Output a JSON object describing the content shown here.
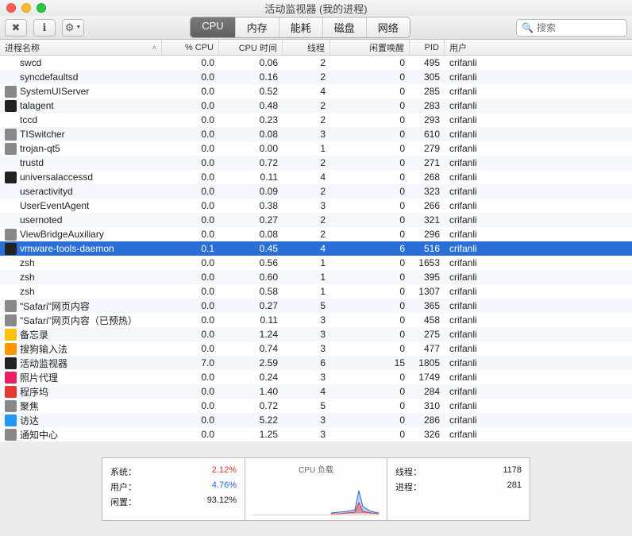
{
  "window": {
    "title": "活动监视器 (我的进程)"
  },
  "toolbar": {
    "stop_icon": "✖",
    "info_icon": "ℹ",
    "gear_icon": "⚙",
    "tabs": [
      "CPU",
      "内存",
      "能耗",
      "磁盘",
      "网络"
    ],
    "search_placeholder": "搜索",
    "search_icon": "🔍"
  },
  "columns": {
    "name": "进程名称",
    "cpu": "% CPU",
    "time": "CPU 时间",
    "thread": "线程",
    "wake": "闲置唤醒",
    "pid": "PID",
    "user": "用户"
  },
  "rows": [
    {
      "icon": "blank",
      "name": "swcd",
      "cpu": "0.0",
      "time": "0.06",
      "thread": "2",
      "wake": "0",
      "pid": "495",
      "user": "crifanli"
    },
    {
      "icon": "blank",
      "name": "syncdefaultsd",
      "cpu": "0.0",
      "time": "0.16",
      "thread": "2",
      "wake": "0",
      "pid": "305",
      "user": "crifanli"
    },
    {
      "icon": "gray",
      "name": "SystemUIServer",
      "cpu": "0.0",
      "time": "0.52",
      "thread": "4",
      "wake": "0",
      "pid": "285",
      "user": "crifanli"
    },
    {
      "icon": "black",
      "name": "talagent",
      "cpu": "0.0",
      "time": "0.48",
      "thread": "2",
      "wake": "0",
      "pid": "283",
      "user": "crifanli"
    },
    {
      "icon": "blank",
      "name": "tccd",
      "cpu": "0.0",
      "time": "0.23",
      "thread": "2",
      "wake": "0",
      "pid": "293",
      "user": "crifanli"
    },
    {
      "icon": "gray",
      "name": "TISwitcher",
      "cpu": "0.0",
      "time": "0.08",
      "thread": "3",
      "wake": "0",
      "pid": "610",
      "user": "crifanli"
    },
    {
      "icon": "gray",
      "name": "trojan-qt5",
      "cpu": "0.0",
      "time": "0.00",
      "thread": "1",
      "wake": "0",
      "pid": "279",
      "user": "crifanli"
    },
    {
      "icon": "blank",
      "name": "trustd",
      "cpu": "0.0",
      "time": "0.72",
      "thread": "2",
      "wake": "0",
      "pid": "271",
      "user": "crifanli"
    },
    {
      "icon": "black",
      "name": "universalaccessd",
      "cpu": "0.0",
      "time": "0.11",
      "thread": "4",
      "wake": "0",
      "pid": "268",
      "user": "crifanli"
    },
    {
      "icon": "blank",
      "name": "useractivityd",
      "cpu": "0.0",
      "time": "0.09",
      "thread": "2",
      "wake": "0",
      "pid": "323",
      "user": "crifanli"
    },
    {
      "icon": "blank",
      "name": "UserEventAgent",
      "cpu": "0.0",
      "time": "0.38",
      "thread": "3",
      "wake": "0",
      "pid": "266",
      "user": "crifanli"
    },
    {
      "icon": "blank",
      "name": "usernoted",
      "cpu": "0.0",
      "time": "0.27",
      "thread": "2",
      "wake": "0",
      "pid": "321",
      "user": "crifanli"
    },
    {
      "icon": "gray",
      "name": "ViewBridgeAuxiliary",
      "cpu": "0.0",
      "time": "0.08",
      "thread": "2",
      "wake": "0",
      "pid": "296",
      "user": "crifanli"
    },
    {
      "icon": "black",
      "name": "vmware-tools-daemon",
      "cpu": "0.1",
      "time": "0.45",
      "thread": "4",
      "wake": "6",
      "pid": "516",
      "user": "crifanli",
      "selected": true
    },
    {
      "icon": "blank",
      "name": "zsh",
      "cpu": "0.0",
      "time": "0.56",
      "thread": "1",
      "wake": "0",
      "pid": "1653",
      "user": "crifanli"
    },
    {
      "icon": "blank",
      "name": "zsh",
      "cpu": "0.0",
      "time": "0.60",
      "thread": "1",
      "wake": "0",
      "pid": "395",
      "user": "crifanli"
    },
    {
      "icon": "blank",
      "name": "zsh",
      "cpu": "0.0",
      "time": "0.58",
      "thread": "1",
      "wake": "0",
      "pid": "1307",
      "user": "crifanli"
    },
    {
      "icon": "gray",
      "name": "\"Safari\"网页内容",
      "cpu": "0.0",
      "time": "0.27",
      "thread": "5",
      "wake": "0",
      "pid": "365",
      "user": "crifanli"
    },
    {
      "icon": "gray",
      "name": "\"Safari\"网页内容（已预热）",
      "cpu": "0.0",
      "time": "0.11",
      "thread": "3",
      "wake": "0",
      "pid": "458",
      "user": "crifanli"
    },
    {
      "icon": "yellow",
      "name": "备忘录",
      "cpu": "0.0",
      "time": "1.24",
      "thread": "3",
      "wake": "0",
      "pid": "275",
      "user": "crifanli"
    },
    {
      "icon": "orange",
      "name": "搜狗输入法",
      "cpu": "0.0",
      "time": "0.74",
      "thread": "3",
      "wake": "0",
      "pid": "477",
      "user": "crifanli"
    },
    {
      "icon": "black",
      "name": "活动监视器",
      "cpu": "7.0",
      "time": "2.59",
      "thread": "6",
      "wake": "15",
      "pid": "1805",
      "user": "crifanli"
    },
    {
      "icon": "pink",
      "name": "照片代理",
      "cpu": "0.0",
      "time": "0.24",
      "thread": "3",
      "wake": "0",
      "pid": "1749",
      "user": "crifanli"
    },
    {
      "icon": "red",
      "name": "程序坞",
      "cpu": "0.0",
      "time": "1.40",
      "thread": "4",
      "wake": "0",
      "pid": "284",
      "user": "crifanli"
    },
    {
      "icon": "gray",
      "name": "聚焦",
      "cpu": "0.0",
      "time": "0.72",
      "thread": "5",
      "wake": "0",
      "pid": "310",
      "user": "crifanli"
    },
    {
      "icon": "blue",
      "name": "访达",
      "cpu": "0.0",
      "time": "5.22",
      "thread": "3",
      "wake": "0",
      "pid": "286",
      "user": "crifanli"
    },
    {
      "icon": "gray",
      "name": "通知中心",
      "cpu": "0.0",
      "time": "1.25",
      "thread": "3",
      "wake": "0",
      "pid": "326",
      "user": "crifanli"
    }
  ],
  "footer": {
    "left": [
      {
        "k": "系统：",
        "v": "2.12%",
        "cls": "red"
      },
      {
        "k": "用户：",
        "v": "4.76%",
        "cls": "blue"
      },
      {
        "k": "闲置：",
        "v": "93.12%",
        "cls": ""
      }
    ],
    "mid_title": "CPU 负载",
    "right": [
      {
        "k": "线程：",
        "v": "1178"
      },
      {
        "k": "进程：",
        "v": "281"
      }
    ]
  },
  "chart_data": {
    "type": "area",
    "title": "CPU 负载",
    "series": [
      {
        "name": "系统",
        "color": "#d33",
        "values": [
          1,
          1,
          2,
          2,
          3,
          8,
          4,
          2,
          2,
          1
        ]
      },
      {
        "name": "用户",
        "color": "#26d",
        "values": [
          2,
          2,
          3,
          3,
          5,
          15,
          7,
          4,
          3,
          2
        ]
      }
    ],
    "ylim": [
      0,
      100
    ]
  }
}
